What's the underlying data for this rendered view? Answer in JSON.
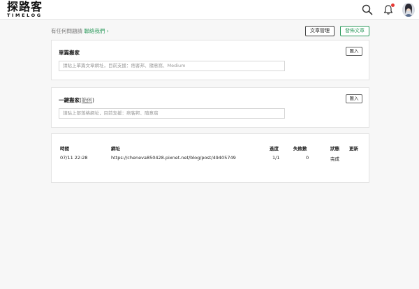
{
  "header": {
    "logo_cn": "探路客",
    "logo_en": "TIMELOG"
  },
  "subbar": {
    "help_text": "有任何問題請 ",
    "contact_text": "聯絡我們",
    "arrow": " ›",
    "manage_label": "文章管理",
    "post_label": "發佈文章"
  },
  "single_import": {
    "title": "單篇搬家",
    "import_label": "匯入",
    "placeholder": "請貼上單篇文章網址，目前支援：痞客邦、隨意窩、Medium"
  },
  "bulk_import": {
    "title": "一鍵搬家",
    "paren_open": "(",
    "sample_label": "範例",
    "paren_close": ")",
    "import_label": "匯入",
    "placeholder": "請貼上部落格網址，目前支援：痞客邦、隨意窩"
  },
  "history": {
    "columns": [
      "時間",
      "網址",
      "進度",
      "失敗數",
      "狀態",
      "更新"
    ],
    "rows": [
      {
        "time": "07/11 22:28",
        "url": "https://cheneva850428.pixnet.net/blog/post/49405749",
        "progress": "1/1",
        "failed": "0",
        "status": "完成",
        "update": ""
      }
    ]
  },
  "colors": {
    "accent_green": "#2e9b5e",
    "notification_dot": "#e53935"
  },
  "icons": [
    "search-icon",
    "bell-icon",
    "avatar"
  ]
}
